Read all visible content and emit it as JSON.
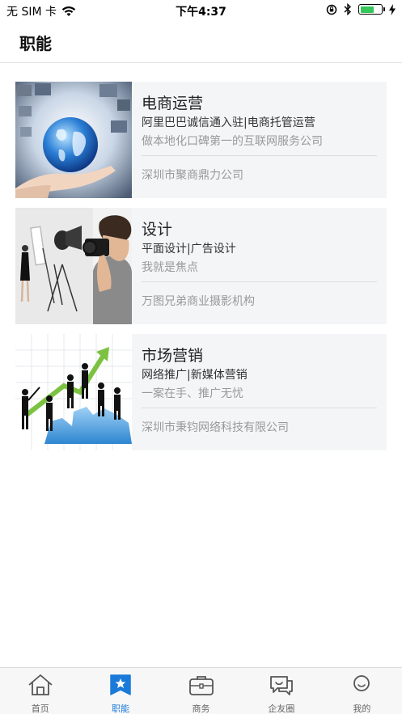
{
  "status_bar": {
    "carrier": "无 SIM 卡",
    "time": "下午4:37",
    "battery_level": 0.6
  },
  "header": {
    "title": "职能"
  },
  "cards": [
    {
      "title": "电商运营",
      "subtitle": "阿里巴巴诚信通入驻|电商托管运营",
      "description": "做本地化口碑第一的互联网服务公司",
      "company": "深圳市聚商鼎力公司",
      "image": "globe-in-hands"
    },
    {
      "title": "设计",
      "subtitle": "平面设计|广告设计",
      "description": "我就是焦点",
      "company": "万图兄弟商业摄影机构",
      "image": "photographer-studio"
    },
    {
      "title": "市场营销",
      "subtitle": "网络推广|新媒体营销",
      "description": "一案在手、推广无忧",
      "company": "深圳市秉钧网络科技有限公司",
      "image": "business-growth"
    }
  ],
  "tab_bar": {
    "tabs": [
      {
        "label": "首页",
        "icon": "home-icon",
        "active": false
      },
      {
        "label": "职能",
        "icon": "star-bookmark-icon",
        "active": true
      },
      {
        "label": "商务",
        "icon": "briefcase-icon",
        "active": false
      },
      {
        "label": "企友圈",
        "icon": "chat-bubbles-icon",
        "active": false
      },
      {
        "label": "我的",
        "icon": "user-icon",
        "active": false
      }
    ]
  },
  "colors": {
    "accent": "#1a7ad9",
    "card_bg": "#f4f5f7",
    "battery_green": "#34c759"
  }
}
